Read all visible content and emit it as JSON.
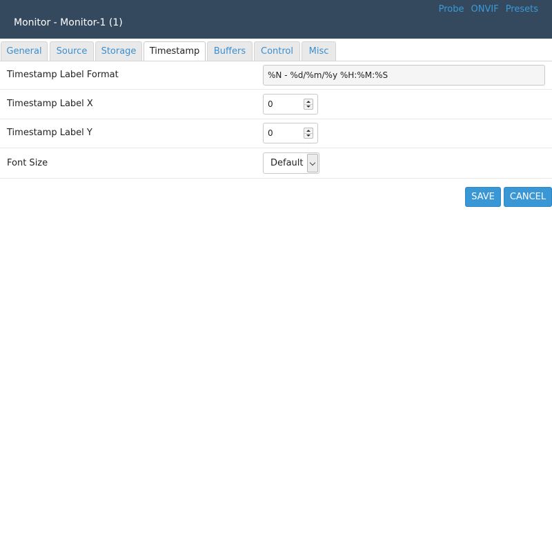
{
  "header": {
    "title": "Monitor - Monitor-1 (1)",
    "links": [
      "Probe",
      "ONVIF",
      "Presets"
    ],
    "background_color": "#34495e",
    "link_color": "#3a9ad9"
  },
  "tabs": [
    {
      "label": "General",
      "active": false
    },
    {
      "label": "Source",
      "active": false
    },
    {
      "label": "Storage",
      "active": false
    },
    {
      "label": "Timestamp",
      "active": true
    },
    {
      "label": "Buffers",
      "active": false
    },
    {
      "label": "Control",
      "active": false
    },
    {
      "label": "Misc",
      "active": false
    }
  ],
  "form": {
    "label_format": {
      "label": "Timestamp Label Format",
      "value": "%N - %d/%m/%y %H:%M:%S"
    },
    "label_x": {
      "label": "Timestamp Label X",
      "value": "0"
    },
    "label_y": {
      "label": "Timestamp Label Y",
      "value": "0"
    },
    "font_size": {
      "label": "Font Size",
      "value": "Default"
    }
  },
  "buttons": {
    "save": "SAVE",
    "cancel": "CANCEL",
    "color": "#3a97d6"
  }
}
